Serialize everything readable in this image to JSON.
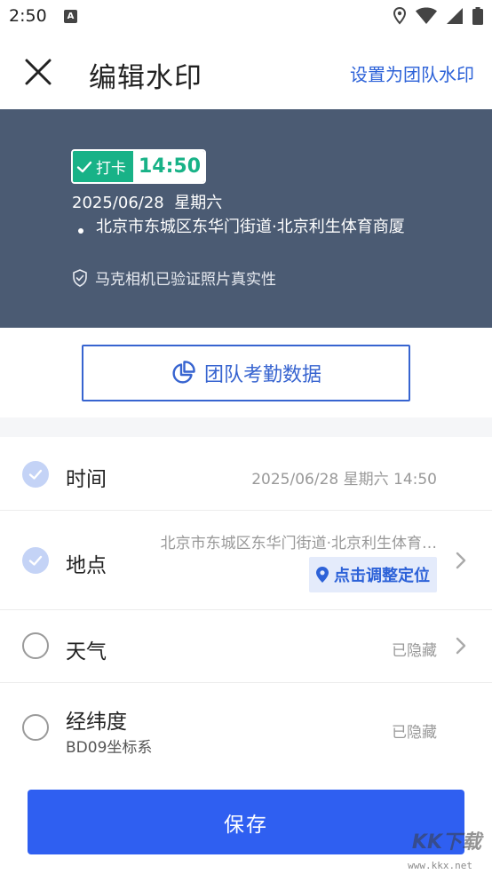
{
  "status_bar": {
    "time": "2:50",
    "notification_badge": "A"
  },
  "header": {
    "title": "编辑水印",
    "team_link": "设置为团队水印"
  },
  "preview": {
    "punch_label": "打卡",
    "time": "14:50",
    "date": "2025/06/28  星期六",
    "address": "北京市东城区东华门街道·北京利生体育商厦",
    "verify_text": "马克相机已验证照片真实性"
  },
  "attendance_button": "团队考勤数据",
  "rows": [
    {
      "label": "时间",
      "value": "2025/06/28 星期六 14:50",
      "checked": true
    },
    {
      "label": "地点",
      "value": "北京市东城区东华门街道·北京利生体育…",
      "action": "点击调整定位",
      "checked": true
    },
    {
      "label": "天气",
      "value": "已隐藏",
      "checked": false
    },
    {
      "label": "经纬度",
      "sub": "BD09坐标系",
      "value": "已隐藏",
      "checked": false
    }
  ],
  "save_button": "保存",
  "site_watermark": {
    "logo": "KK下载",
    "url": "www.kkx.net"
  },
  "colors": {
    "accent": "#2f5ff1",
    "preview_bg": "#4b5b73",
    "punch_green": "#18b287",
    "link_blue": "#2d62d8"
  }
}
